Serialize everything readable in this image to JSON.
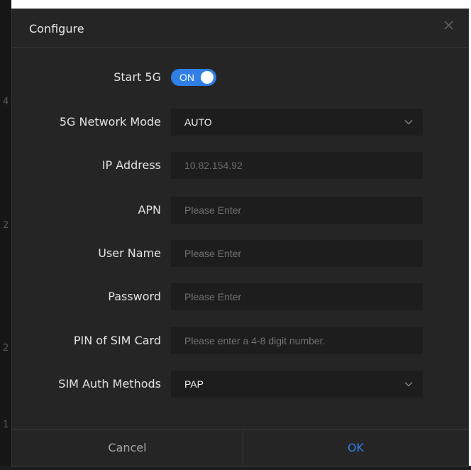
{
  "background": {
    "edge_glyphs": [
      "4",
      "2",
      "2",
      "1"
    ]
  },
  "dialog": {
    "title": "Configure",
    "close_icon": "close-icon"
  },
  "form": {
    "start_5g": {
      "label": "Start 5G",
      "toggle_text": "ON",
      "enabled": true
    },
    "network_mode": {
      "label": "5G Network Mode",
      "value": "AUTO",
      "icon": "chevron-down-icon"
    },
    "ip_address": {
      "label": "IP Address",
      "value": "10.82.154.92"
    },
    "apn": {
      "label": "APN",
      "value": "",
      "placeholder": "Please Enter"
    },
    "user_name": {
      "label": "User Name",
      "value": "",
      "placeholder": "Please Enter"
    },
    "password": {
      "label": "Password",
      "value": "",
      "placeholder": "Please Enter"
    },
    "pin": {
      "label": "PIN of SIM Card",
      "value": "",
      "placeholder": "Please enter a 4-8 digit number."
    },
    "auth_method": {
      "label": "SIM Auth Methods",
      "value": "PAP",
      "icon": "chevron-down-icon"
    }
  },
  "footer": {
    "cancel_label": "Cancel",
    "ok_label": "OK"
  },
  "colors": {
    "dialog_bg": "#252525",
    "field_bg": "#1d1d1d",
    "accent": "#2f7fe6",
    "label_text": "#e3e3e3",
    "placeholder_text": "#727272"
  }
}
